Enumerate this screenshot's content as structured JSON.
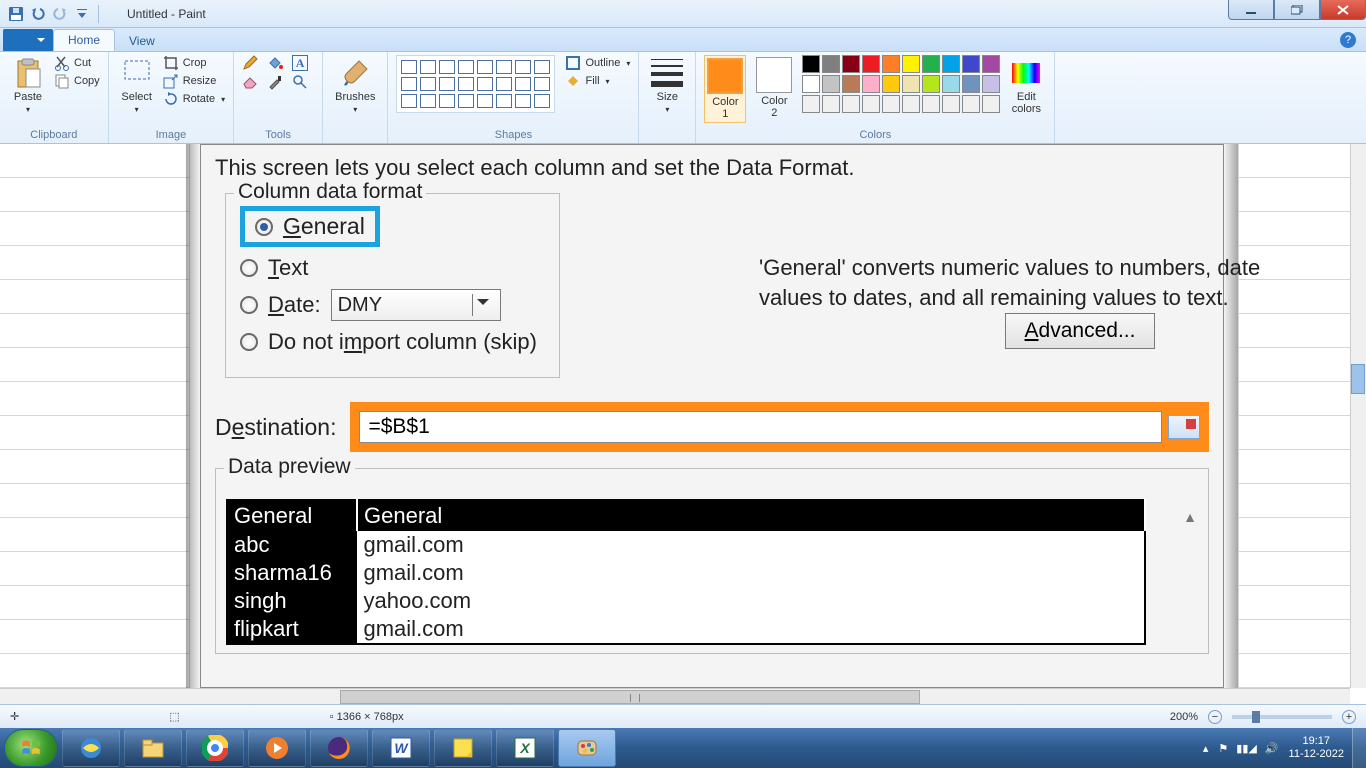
{
  "titlebar": {
    "title": "Untitled - Paint"
  },
  "tabs": {
    "home": "Home",
    "view": "View"
  },
  "ribbon": {
    "clipboard": {
      "label": "Clipboard",
      "paste": "Paste",
      "cut": "Cut",
      "copy": "Copy"
    },
    "image": {
      "label": "Image",
      "select": "Select",
      "crop": "Crop",
      "resize": "Resize",
      "rotate": "Rotate"
    },
    "tools": {
      "label": "Tools"
    },
    "brushes": {
      "label": "Brushes"
    },
    "shapes": {
      "label": "Shapes",
      "outline": "Outline",
      "fill": "Fill"
    },
    "size": {
      "label": "Size"
    },
    "colors": {
      "label": "Colors",
      "color1": "Color\n1",
      "color2": "Color\n2",
      "edit": "Edit\ncolors"
    }
  },
  "dialog": {
    "intro": "This screen lets you select each column and set the Data Format.",
    "column_format_legend": "Column data format",
    "radio_general": "General",
    "radio_text": "Text",
    "radio_date": "Date:",
    "date_value": "DMY",
    "radio_skip": "Do not import column (skip)",
    "side_text": "'General' converts numeric values to numbers, date values to dates, and all remaining values to text.",
    "advanced": "Advanced...",
    "destination_label": "Destination:",
    "destination_value": "=$B$1",
    "preview_legend": "Data preview",
    "preview": {
      "headers": [
        "General",
        "General"
      ],
      "rows": [
        [
          "abc",
          "gmail.com"
        ],
        [
          "sharma16",
          "gmail.com"
        ],
        [
          "singh",
          "yahoo.com"
        ],
        [
          "flipkart",
          "gmail.com"
        ]
      ]
    }
  },
  "statusbar": {
    "dimensions": "1366 × 768px",
    "zoom": "200%"
  },
  "tray": {
    "time": "19:17",
    "date": "11-12-2022"
  },
  "palette_row1": [
    "#000000",
    "#7f7f7f",
    "#880015",
    "#ed1c24",
    "#ff7f27",
    "#fff200",
    "#22b14c",
    "#00a2e8",
    "#3f48cc",
    "#a349a4"
  ],
  "palette_row2": [
    "#ffffff",
    "#c3c3c3",
    "#b97a57",
    "#ffaec9",
    "#ffc90e",
    "#efe4b0",
    "#b5e61d",
    "#99d9ea",
    "#7092be",
    "#c8bfe7"
  ],
  "palette_row3": [
    "#f0f0f0",
    "#f0f0f0",
    "#f0f0f0",
    "#f0f0f0",
    "#f0f0f0",
    "#f0f0f0",
    "#f0f0f0",
    "#f0f0f0",
    "#f0f0f0",
    "#f0f0f0"
  ]
}
